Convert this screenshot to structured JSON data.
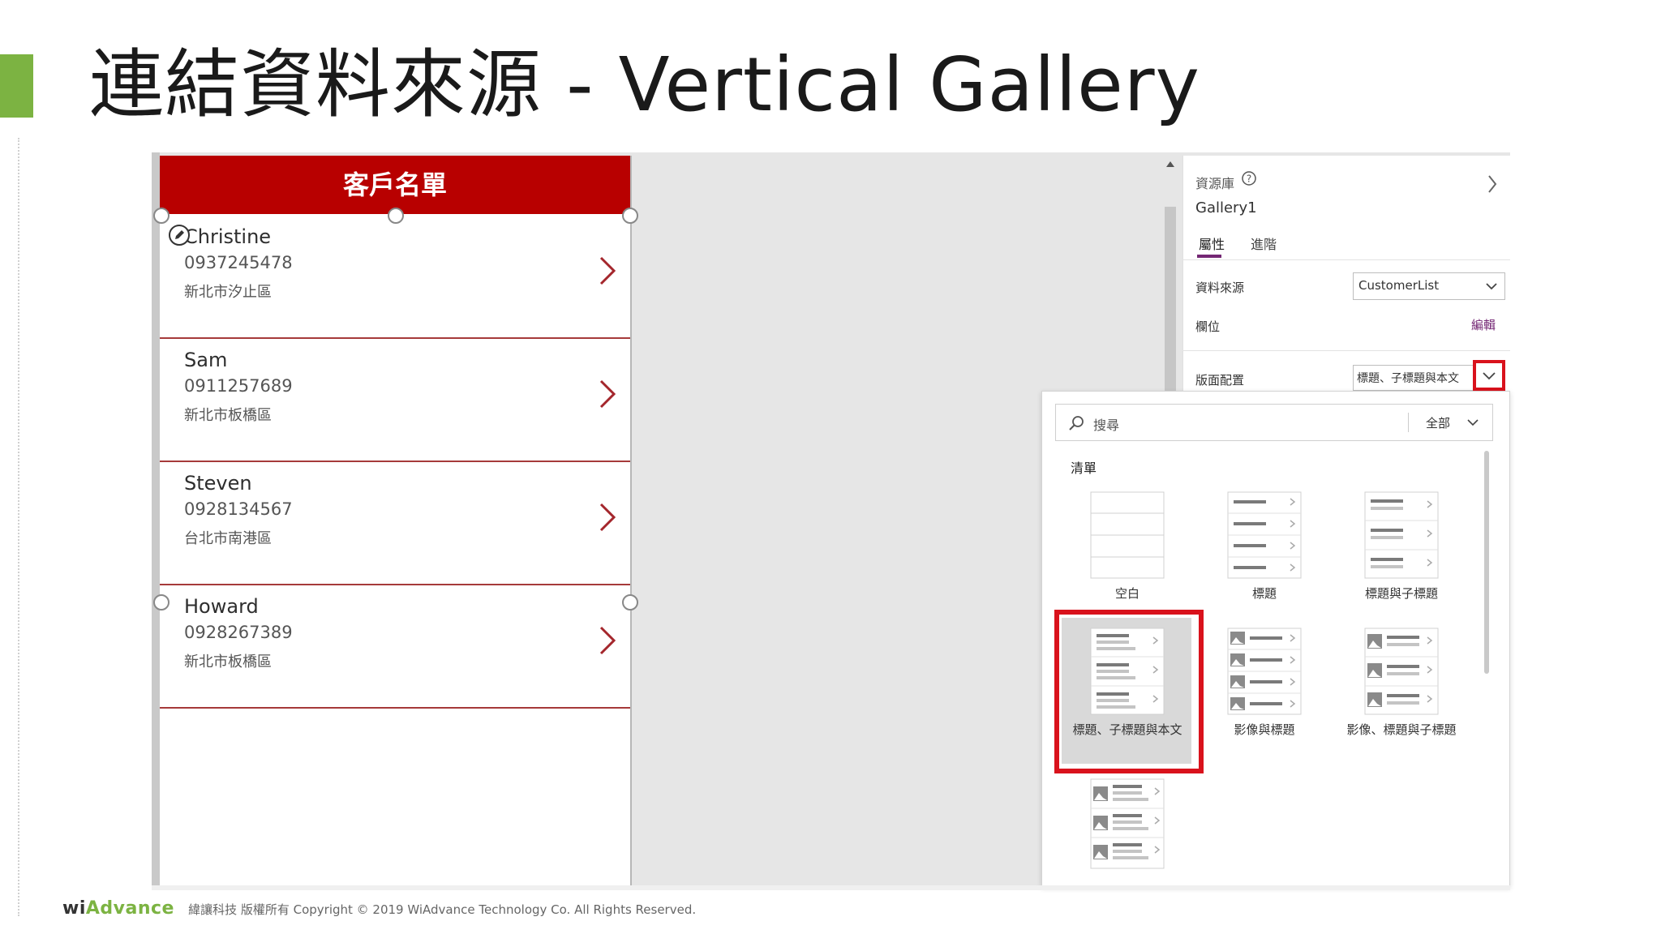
{
  "slide": {
    "title": "連結資料來源 - Vertical Gallery",
    "footer_logo_a": "wi",
    "footer_logo_b": "Advance",
    "footer_copyright": "緯讓科技 版權所有 Copyright © 2019 WiAdvance Technology Co. All Rights Reserved.",
    "accent_color": "#7cb342"
  },
  "app": {
    "header_title": "客戶名單",
    "header_color": "#b80000",
    "items": [
      {
        "name": "Christine",
        "phone": "0937245478",
        "address": "新北市汐止區"
      },
      {
        "name": "Sam",
        "phone": "0911257689",
        "address": "新北市板橋區"
      },
      {
        "name": "Steven",
        "phone": "0928134567",
        "address": "台北市南港區"
      },
      {
        "name": "Howard",
        "phone": "0928267389",
        "address": "新北市板橋區"
      }
    ]
  },
  "properties": {
    "section_label": "資源庫",
    "control_name": "Gallery1",
    "tab_properties": "屬性",
    "tab_advanced": "進階",
    "datasource_label": "資料來源",
    "datasource_value": "CustomerList",
    "fields_label": "欄位",
    "fields_edit": "編輯",
    "layout_label": "版面配置",
    "layout_value": "標題、子標題與本文",
    "highlight_color": "#d9121c"
  },
  "layout_picker": {
    "search_placeholder": "搜尋",
    "filter_value": "全部",
    "section_label": "清單",
    "tiles": [
      {
        "label": "空白"
      },
      {
        "label": "標題"
      },
      {
        "label": "標題與子標題"
      },
      {
        "label": "標題、子標題與本文"
      },
      {
        "label": "影像與標題"
      },
      {
        "label": "影像、標題與子標題"
      }
    ],
    "selected": "標題、子標題與本文"
  }
}
